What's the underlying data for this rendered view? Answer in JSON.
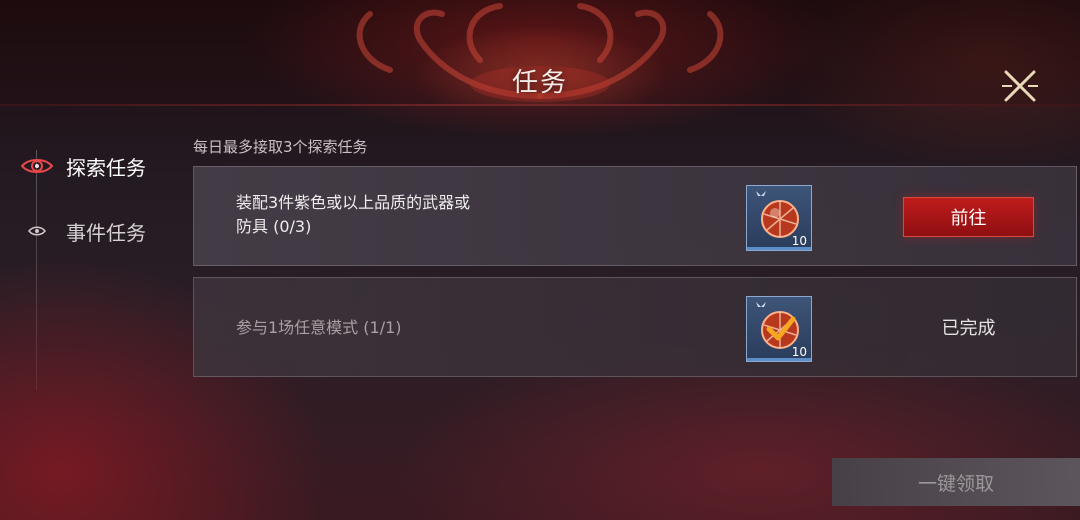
{
  "header": {
    "title": "任务"
  },
  "sidebar": {
    "items": [
      {
        "label": "探索任务",
        "active": true
      },
      {
        "label": "事件任务",
        "active": false
      }
    ]
  },
  "main": {
    "hint": "每日最多接取3个探索任务",
    "tasks": [
      {
        "description_line1": "装配3件紫色或以上品质的武器或",
        "description_line2": "防具 (0/3)",
        "reward_count": "10",
        "action_label": "前往"
      },
      {
        "description_line1": "参与1场任意模式 (1/1)",
        "reward_count": "10",
        "status_label": "已完成"
      }
    ],
    "claim_all_label": "一键领取"
  },
  "colors": {
    "accent_red": "#c11c1c",
    "reward_frame": "#8aa8d0"
  }
}
